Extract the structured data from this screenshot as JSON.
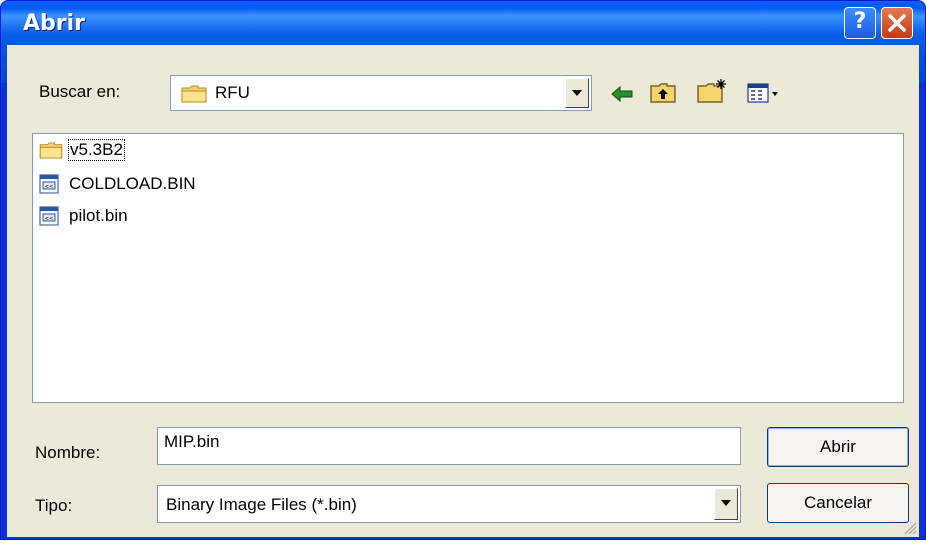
{
  "window": {
    "title": "Abrir",
    "help_label": "?",
    "close_label": "X"
  },
  "toolbar": {
    "look_in_label": "Buscar en:",
    "look_in_value": "RFU",
    "icons": [
      "back-arrow-icon",
      "up-folder-icon",
      "new-folder-icon",
      "view-menu-icon"
    ]
  },
  "files": [
    {
      "name": "v5.3B2",
      "type": "folder"
    },
    {
      "name": "COLDLOAD.BIN",
      "type": "bin"
    },
    {
      "name": "pilot.bin",
      "type": "bin"
    }
  ],
  "filename": {
    "label": "Nombre:",
    "value": "MIP.bin"
  },
  "filetype": {
    "label": "Tipo:",
    "value": "Binary Image Files (*.bin)"
  },
  "buttons": {
    "open": "Abrir",
    "cancel": "Cancelar"
  },
  "colors": {
    "title_bar": "#0054e3",
    "dialog_bg": "#ece9d8",
    "close_btn": "#e05a32"
  }
}
